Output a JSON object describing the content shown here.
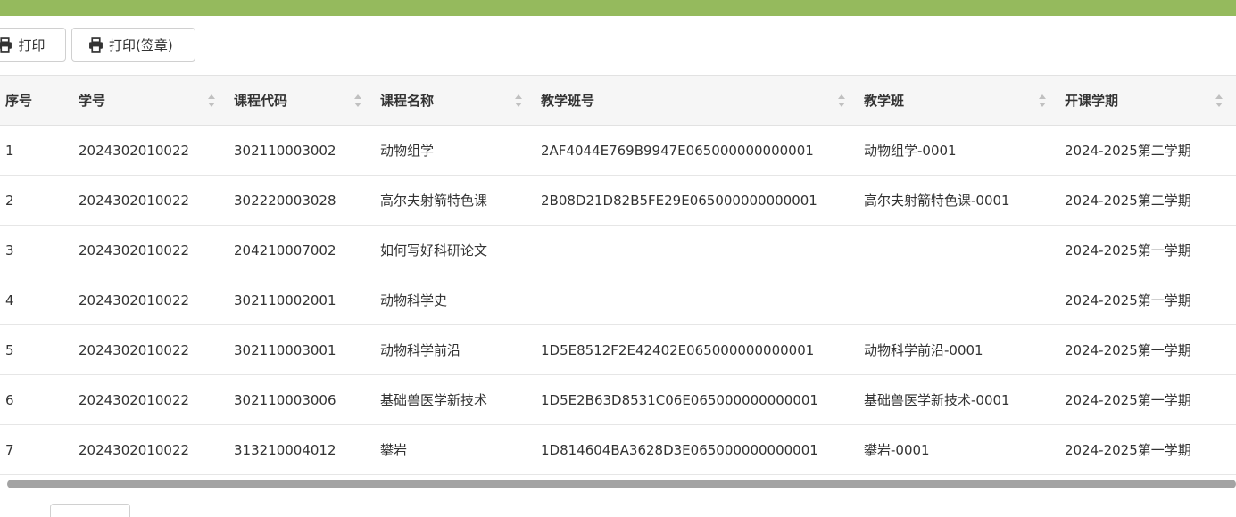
{
  "toolbar": {
    "print_label": "打印",
    "print_seal_label": "打印(签章)",
    "icon": "printer-icon"
  },
  "colors": {
    "topbar": "#95ba5d",
    "header_bg": "#f6f6f6",
    "scrollbar": "#a3a3a3"
  },
  "table": {
    "columns": [
      "序号",
      "学号",
      "课程代码",
      "课程名称",
      "教学班号",
      "教学班",
      "开课学期"
    ],
    "rows": [
      [
        "1",
        "2024302010022",
        "302110003002",
        "动物组学",
        "2AF4044E769B9947E065000000000001",
        "动物组学-0001",
        "2024-2025第二学期"
      ],
      [
        "2",
        "2024302010022",
        "302220003028",
        "高尔夫射箭特色课",
        "2B08D21D82B5FE29E065000000000001",
        "高尔夫射箭特色课-0001",
        "2024-2025第二学期"
      ],
      [
        "3",
        "2024302010022",
        "204210007002",
        "如何写好科研论文",
        "",
        "",
        "2024-2025第一学期"
      ],
      [
        "4",
        "2024302010022",
        "302110002001",
        "动物科学史",
        "",
        "",
        "2024-2025第一学期"
      ],
      [
        "5",
        "2024302010022",
        "302110003001",
        "动物科学前沿",
        "1D5E8512F2E42402E065000000000001",
        "动物科学前沿-0001",
        "2024-2025第一学期"
      ],
      [
        "6",
        "2024302010022",
        "302110003006",
        "基础兽医学新技术",
        "1D5E2B63D8531C06E065000000000001",
        "基础兽医学新技术-0001",
        "2024-2025第一学期"
      ],
      [
        "7",
        "2024302010022",
        "313210004012",
        "攀岩",
        "1D814604BA3628D3E065000000000001",
        "攀岩-0001",
        "2024-2025第一学期"
      ]
    ]
  }
}
